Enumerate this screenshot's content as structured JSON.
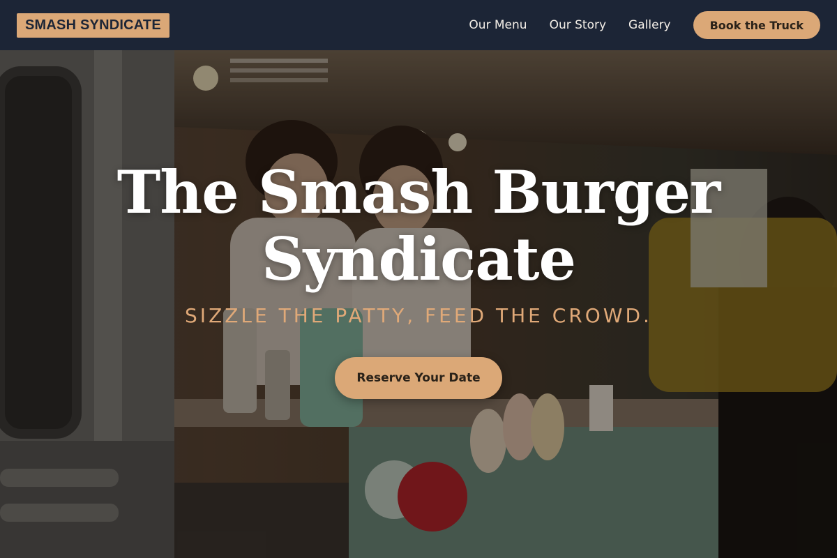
{
  "nav": {
    "logo_text": "SMASH SYNDICATE",
    "links": [
      "Our Menu",
      "Our Story",
      "Gallery"
    ],
    "cta_label": "Book the Truck"
  },
  "hero": {
    "title_line1": "The Smash Burger",
    "title_line2": "Syndicate",
    "tagline": "SIZZLE THE PATTY, FEED THE CROWD.",
    "button_label": "Reserve Your Date",
    "background_image": "food-truck-photo"
  },
  "colors": {
    "nav_bg": "#1c2536",
    "accent": "#dba877",
    "tagline": "#e0a978",
    "title": "#ffffff"
  }
}
